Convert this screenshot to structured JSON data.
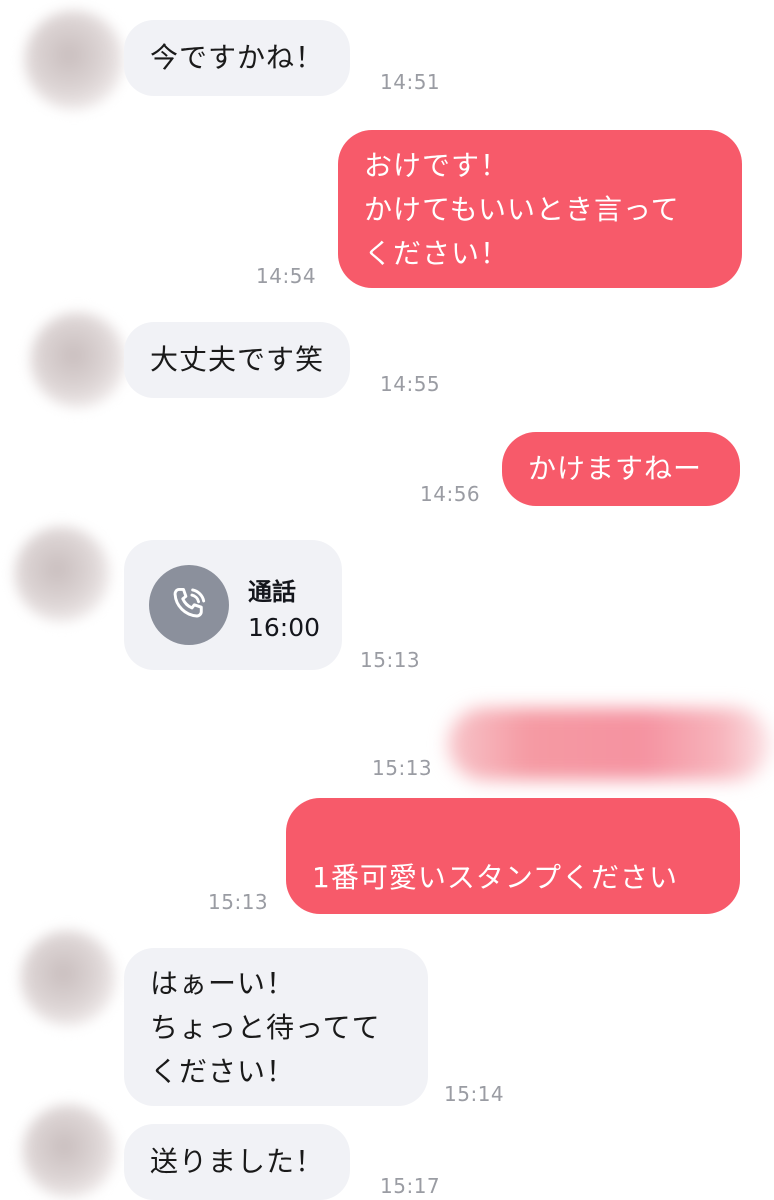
{
  "messages": {
    "m1": {
      "text": "今ですかね！",
      "time": "14:51"
    },
    "m2": {
      "text": "おけです！\nかけてもいいとき言って\nください！",
      "time": "14:54"
    },
    "m3": {
      "text": "大丈夫です笑",
      "time": "14:55"
    },
    "m4": {
      "text": "かけますねー",
      "time": "14:56"
    },
    "m5": {
      "title": "通話",
      "duration": "16:00",
      "time": "15:13",
      "icon": "phone-call-icon"
    },
    "m6": {
      "time": "15:13"
    },
    "m7": {
      "text": "1番可愛いスタンプください",
      "emoji": "😎",
      "time": "15:13"
    },
    "m8": {
      "text": "はぁーい！\nちょっと待ってて\nください！",
      "time": "15:14"
    },
    "m9": {
      "text": "送りました！",
      "time": "15:17"
    }
  },
  "colors": {
    "incoming_bubble": "#f1f2f6",
    "outgoing_bubble": "#f75a6a",
    "timestamp": "#9a9ca3",
    "call_icon_bg": "#8b909c"
  }
}
